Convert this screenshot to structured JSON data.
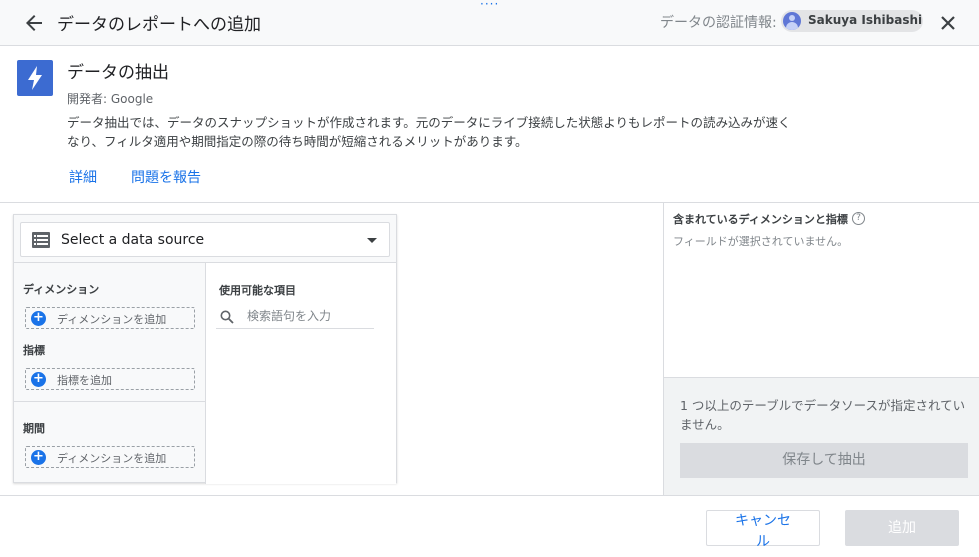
{
  "header": {
    "title": "データのレポートへの追加",
    "credentials_label": "データの認証情報:",
    "account_name": "Sakuya Ishibashi"
  },
  "connector": {
    "title": "データの抽出",
    "developer": "開発者: Google",
    "description": "データ抽出では、データのスナップショットが作成されます。元のデータにライブ接続した状態よりもレポートの読み込みが速くなり、フィルタ適用や期間指定の際の待ち時間が短縮されるメリットがあります。",
    "link_details": "詳細",
    "link_report": "問題を報告"
  },
  "editor": {
    "data_source_label": "Select a data source",
    "dimensions_label": "ディメンション",
    "add_dimension": "ディメンションを追加",
    "metrics_label": "指標",
    "add_metric": "指標を追加",
    "period_label": "期間",
    "add_period_dimension": "ディメンションを追加",
    "available_fields_label": "使用可能な項目",
    "search_placeholder": "検索語句を入力"
  },
  "included": {
    "title": "含まれているディメンションと指標",
    "empty_text": "フィールドが選択されていません。",
    "notice": "1 つ以上のテーブルでデータソースが指定されていません。",
    "save_extract": "保存して抽出"
  },
  "footer": {
    "cancel": "キャンセル",
    "add": "追加"
  },
  "colors": {
    "accent": "#1a73e8",
    "connector_icon": "#3c6bd1",
    "disabled": "#dadce0"
  },
  "icons": {
    "back": "arrow-left-icon",
    "close": "close-icon",
    "connector": "lightning-bolt-icon",
    "data_source": "table-icon",
    "add": "plus-circle-icon",
    "search": "search-icon",
    "help": "help-icon"
  }
}
